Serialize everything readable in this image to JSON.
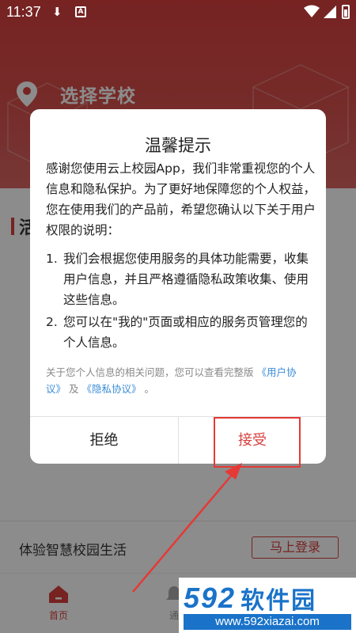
{
  "status_bar": {
    "time": "11:37"
  },
  "header": {
    "location_label": "选择学校"
  },
  "section": {
    "title": "活"
  },
  "promo": {
    "text": "体验智慧校园生活",
    "login_button": "马上登录"
  },
  "tabbar": {
    "home_label": "首页",
    "notify_label": "通"
  },
  "dialog": {
    "title": "温馨提示",
    "intro": "感谢您使用云上校园App，我们非常重视您的个人信息和隐私保护。为了更好地保障您的个人权益，您在使用我们的产品前，希望您确认以下关于用户权限的说明：",
    "items": [
      {
        "num": "1.",
        "text": "我们会根据您使用服务的具体功能需要，收集用户信息，并且严格遵循隐私政策收集、使用这些信息。"
      },
      {
        "num": "2.",
        "text": "您可以在\"我的\"页面或相应的服务页管理您的个人信息。"
      }
    ],
    "note_prefix": "关于您个人信息的相关问题，您可以查看完整版",
    "user_agreement_link": "《用户协议》",
    "note_and": "及",
    "privacy_link": "《隐私协议》",
    "note_end": "。",
    "reject_button": "拒绝",
    "accept_button": "接受"
  },
  "watermark": {
    "number": "592",
    "name": "软件园",
    "url": "www.592xiazai.com"
  },
  "colors": {
    "brand_red": "#d8403f",
    "link_blue": "#3b8cd8",
    "watermark_blue": "#1a73c9"
  }
}
